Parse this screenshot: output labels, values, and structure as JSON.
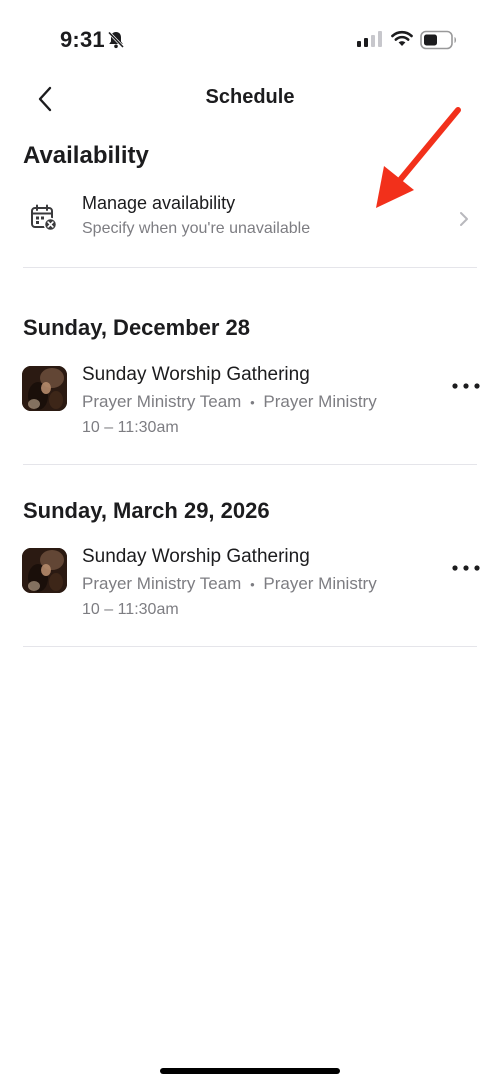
{
  "status_bar": {
    "time": "9:31",
    "icons": [
      "bell-slash-icon",
      "signal-icon",
      "wifi-icon",
      "battery-icon"
    ]
  },
  "nav": {
    "title": "Schedule",
    "back_icon": "chevron-left-icon"
  },
  "availability": {
    "heading": "Availability",
    "row": {
      "title": "Manage availability",
      "subtitle": "Specify when you're unavailable",
      "icon": "calendar-x-icon"
    }
  },
  "schedule": [
    {
      "date": "Sunday, December 28",
      "event": {
        "title": "Sunday Worship Gathering",
        "team": "Prayer Ministry Team",
        "separator": "•",
        "ministry": "Prayer Ministry",
        "time": "10 – 11:30am"
      }
    },
    {
      "date": "Sunday, March 29, 2026",
      "event": {
        "title": "Sunday Worship Gathering",
        "team": "Prayer Ministry Team",
        "separator": "•",
        "ministry": "Prayer Ministry",
        "time": "10 – 11:30am"
      }
    }
  ],
  "colors": {
    "text_primary": "#1c1c1e",
    "text_secondary": "#7d7d82",
    "divider": "#e5e5ea",
    "annotation_arrow": "#f2301b"
  }
}
